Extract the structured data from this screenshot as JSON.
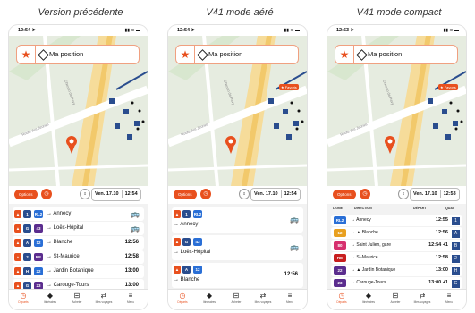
{
  "captions": [
    "Version précédente",
    "V41 mode aéré",
    "V41 mode compact"
  ],
  "phones": [
    {
      "time": "12:54",
      "search": "Ma position",
      "options": "Options",
      "date": "Ven. 17.10",
      "clock": "12:54"
    },
    {
      "time": "12:54",
      "search": "Ma position",
      "options": "Options",
      "date": "Ven. 17.10",
      "clock": "12:54",
      "favoris": "Favoris"
    },
    {
      "time": "12:53",
      "search": "Ma position",
      "options": "Options",
      "date": "Ven. 17.10",
      "clock": "12:53",
      "favoris": "Favoris"
    }
  ],
  "p1_rows": [
    {
      "line": "1",
      "line2": "RL2",
      "dest": "→ Annecy",
      "time": ""
    },
    {
      "line": "G",
      "line2": "43",
      "dest": "→ Loëx-Hôpital",
      "time": ""
    },
    {
      "line": "A",
      "line2": "12",
      "dest": "→ Blanche",
      "time": "12:56"
    },
    {
      "line": "2",
      "line2": "RE",
      "dest": "→ St-Maurice",
      "time": "12:58"
    },
    {
      "line": "H",
      "line2": "22",
      "dest": "→ Jardin Botanique",
      "time": "13:00"
    },
    {
      "line": "G",
      "line2": "23",
      "dest": "→ Carouge-Tours",
      "time": "13:00"
    }
  ],
  "p2_rows": [
    {
      "line": "1",
      "line2": "RL2",
      "dest": "→ Annecy",
      "time": ""
    },
    {
      "line": "G",
      "line2": "43",
      "dest": "→ Loëx-Hôpital",
      "time": ""
    },
    {
      "line": "A",
      "line2": "12",
      "dest": "→ Blanche",
      "time": "12:56"
    }
  ],
  "p3_headers": {
    "ligne": "LIGNE",
    "direction": "DIRECTION",
    "depart": "DÉPART",
    "quai": "QUAI"
  },
  "p3_rows": [
    {
      "line": "RL2",
      "dest": "→ Annecy",
      "time": "12:55",
      "quai": "1"
    },
    {
      "line": "12",
      "dest": "→ ▲ Blanche",
      "time": "12:56",
      "quai": "A"
    },
    {
      "line": "80",
      "dest": "→ Saint Julien, gare",
      "time": "12:54 +1",
      "quai": "B"
    },
    {
      "line": "RE",
      "dest": "→ St-Maurice",
      "time": "12:58",
      "quai": "2"
    },
    {
      "line": "22",
      "dest": "→ ▲ Jardin Botanique",
      "time": "13:00",
      "quai": "H"
    },
    {
      "line": "23",
      "dest": "→ Carouge-Tours",
      "time": "13:00 +1",
      "quai": "G"
    }
  ],
  "tabs": [
    "Départs",
    "Itinéraires",
    "Acheter",
    "Mes voyages",
    "Menu"
  ],
  "streets": [
    "Chemin de Pavy",
    "Route des Jeunes"
  ],
  "colors": {
    "accent": "#e8501e",
    "rail": "#2a4d8e",
    "tram": "#5b2d8e"
  }
}
